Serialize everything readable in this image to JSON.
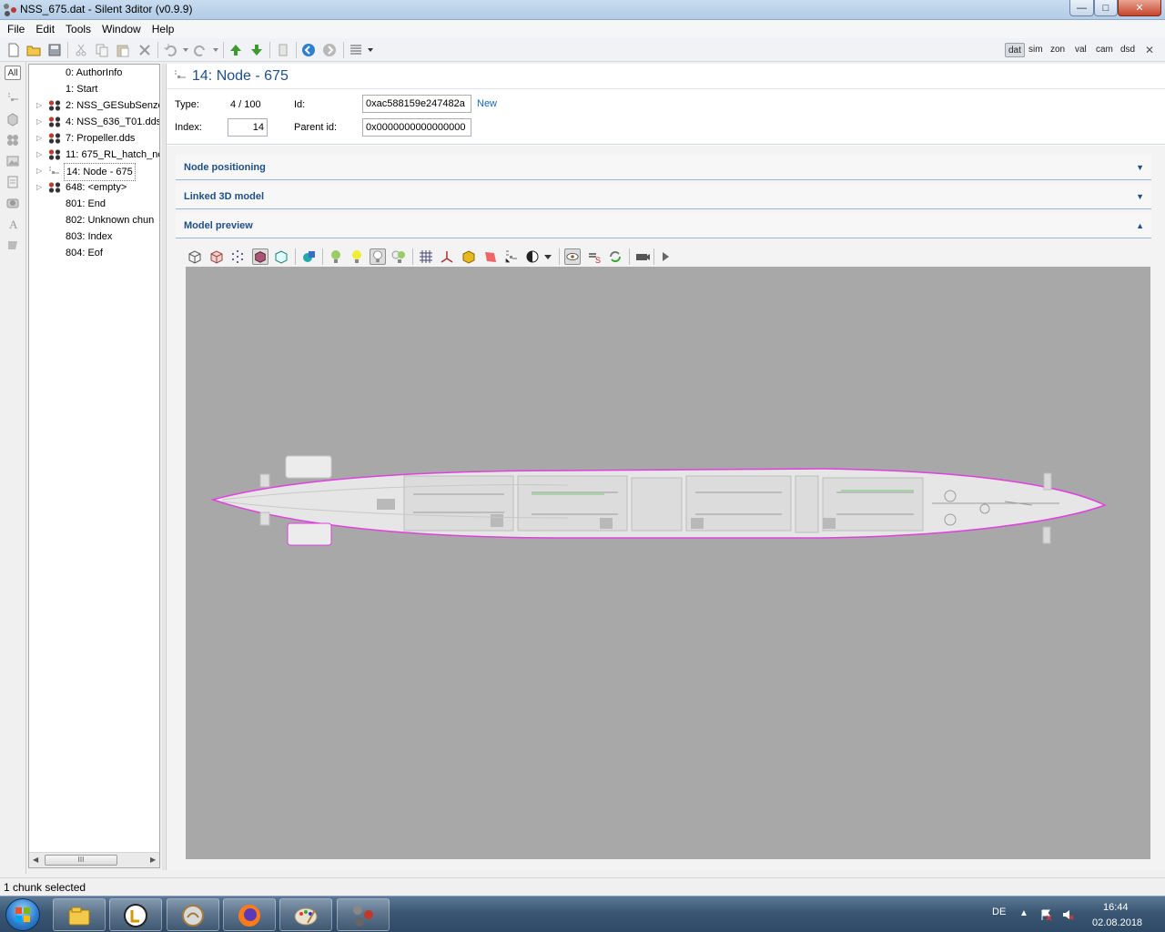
{
  "window": {
    "title": "NSS_675.dat - Silent 3ditor (v0.9.9)",
    "minimize_glyph": "—",
    "maximize_glyph": "□",
    "close_glyph": "✕"
  },
  "menu": [
    "File",
    "Edit",
    "Tools",
    "Window",
    "Help"
  ],
  "toolbar": {
    "icons": [
      "new-file-icon",
      "open-folder-icon",
      "save-icon",
      "cut-icon",
      "copy-icon",
      "paste-icon",
      "delete-icon",
      "undo-icon",
      "redo-icon",
      "move-up-icon",
      "move-down-icon",
      "chunk-icon",
      "back-icon",
      "forward-icon",
      "view-list-icon"
    ],
    "view_toggles": [
      "dat",
      "sim",
      "zon",
      "val",
      "cam",
      "dsd"
    ],
    "active_view": "dat",
    "close_glyph": "✕"
  },
  "filter_strip": {
    "all_label": "All"
  },
  "tree": {
    "items": [
      {
        "label": "0: AuthorInfo",
        "expandable": false,
        "icon": "none"
      },
      {
        "label": "1: Start",
        "expandable": false,
        "icon": "none"
      },
      {
        "label": "2: NSS_GESubSenzo",
        "expandable": true,
        "icon": "material-icon"
      },
      {
        "label": "4: NSS_636_T01.dds",
        "expandable": true,
        "icon": "material-icon"
      },
      {
        "label": "7: Propeller.dds",
        "expandable": true,
        "icon": "material-icon"
      },
      {
        "label": "11: 675_RL_hatch_nc",
        "expandable": true,
        "icon": "material-icon"
      },
      {
        "label": "14: Node - 675",
        "expandable": true,
        "icon": "node-icon",
        "selected": true
      },
      {
        "label": "648: <empty>",
        "expandable": true,
        "icon": "material-icon"
      },
      {
        "label": "801: End",
        "expandable": false,
        "icon": "none"
      },
      {
        "label": "802: Unknown chun",
        "expandable": false,
        "icon": "none"
      },
      {
        "label": "803: Index",
        "expandable": false,
        "icon": "none"
      },
      {
        "label": "804: Eof",
        "expandable": false,
        "icon": "none"
      }
    ],
    "scroll_left": "◀",
    "scroll_right": "▶",
    "scroll_thumb_glyph": "III"
  },
  "detail": {
    "title": "14: Node - 675",
    "type_label": "Type:",
    "type_value": "4 / 100",
    "id_label": "Id:",
    "id_value": "0xac588159e247482a",
    "id_new_link": "New",
    "index_label": "Index:",
    "index_value": "14",
    "parent_id_label": "Parent id:",
    "parent_id_value": "0x0000000000000000"
  },
  "sections": [
    {
      "title": "Node positioning",
      "expanded": false,
      "chevron": "▼"
    },
    {
      "title": "Linked 3D model",
      "expanded": false,
      "chevron": "▼"
    },
    {
      "title": "Model preview",
      "expanded": true,
      "chevron": "▲"
    }
  ],
  "preview_toolbar": {
    "icons": [
      "wireframe-box-icon",
      "solid-box-icon",
      "points-icon",
      "shaded-box-icon",
      "bounding-box-icon",
      "texture-icon",
      "light-1-icon",
      "light-2-icon",
      "light-3-icon",
      "light-4-icon",
      "grid-icon",
      "axes-icon",
      "cube-icon",
      "plane-icon",
      "normals-icon",
      "contrast-icon",
      "eye-icon",
      "shader-icon",
      "refresh-icon",
      "camera-icon",
      "play-icon"
    ],
    "active": [
      "shaded-box-icon",
      "light-3-icon",
      "eye-icon"
    ]
  },
  "viewport": {
    "background": "#a8a8a8",
    "model_color": "#e8e8e8",
    "outline_color": "#e040e0"
  },
  "status": {
    "text": "1 chunk selected"
  },
  "taskbar": {
    "apps": [
      "explorer-icon",
      "launcher-icon",
      "app-icon",
      "firefox-icon",
      "paint-icon",
      "silent3ditor-icon"
    ],
    "language": "DE",
    "time": "16:44",
    "date": "02.08.2018"
  }
}
